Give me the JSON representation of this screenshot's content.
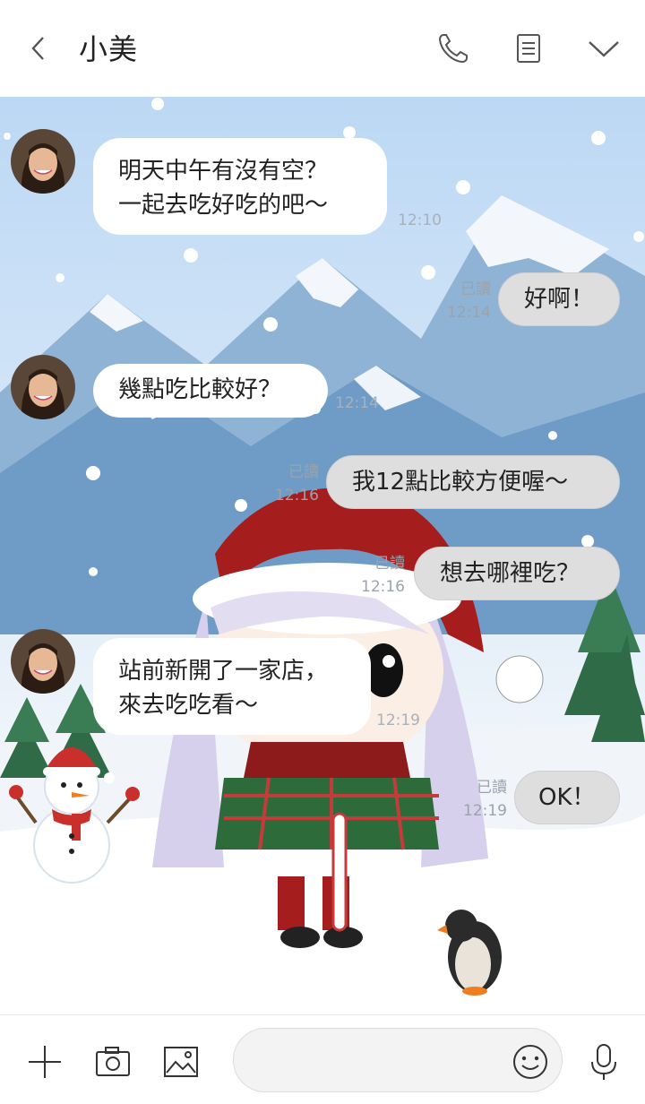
{
  "header": {
    "back_icon": "chevron-left-icon",
    "title": "小美",
    "actions": [
      "phone-icon",
      "notes-icon",
      "chevron-down-icon"
    ]
  },
  "messages": [
    {
      "side": "in",
      "text": "明天中午有沒有空？\n一起去吃好吃的吧〜",
      "time": "12:10"
    },
    {
      "side": "out",
      "text": "好啊！",
      "read": "已讀",
      "time": "12:14"
    },
    {
      "side": "in",
      "text": "幾點吃比較好？",
      "time": "12:14"
    },
    {
      "side": "out",
      "text": "我12點比較方便喔〜",
      "read": "已讀",
      "time": "12:16"
    },
    {
      "side": "out",
      "text": "想去哪裡吃？",
      "read": "已讀",
      "time": "12:16"
    },
    {
      "side": "in",
      "text": "站前新開了一家店，\n來去吃吃看〜",
      "time": "12:19"
    },
    {
      "side": "out",
      "text": "OK！",
      "read": "已讀",
      "time": "12:19"
    }
  ],
  "footer": {
    "icons": [
      "plus-icon",
      "camera-icon",
      "image-icon",
      "emoji-icon",
      "microphone-icon"
    ],
    "input_value": ""
  },
  "colors": {
    "bubble_in": "#ffffff",
    "bubble_out": "#dedede",
    "sky": "#bcd8f4"
  }
}
